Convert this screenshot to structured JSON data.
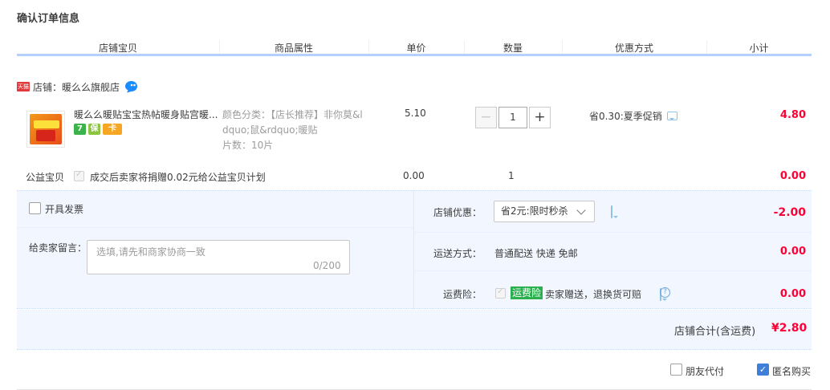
{
  "page": {
    "title": "确认订单信息"
  },
  "columns": [
    "店铺宝贝",
    "商品属性",
    "单价",
    "数量",
    "优惠方式",
    "小计"
  ],
  "shop": {
    "badge": "天猫",
    "label": "店铺：暖么么旗舰店"
  },
  "item": {
    "title": "暖么么暖贴宝宝热帖暖身贴宫暖...",
    "service_icons": [
      "7",
      "保",
      "卡"
    ],
    "attr_line1": "颜色分类：【店长推荐】非你莫&l",
    "attr_line2": "dquo;鼠&rdquo;暖贴",
    "attr_line3": "片数：10片",
    "price": "5.10",
    "quantity": "1",
    "qty_minus": "−",
    "qty_plus": "+",
    "promo": "省0.30:夏季促销",
    "subtotal": "4.80"
  },
  "charity": {
    "label": "公益宝贝",
    "text": "成交后卖家将捐赠0.02元给公益宝贝计划",
    "price": "0.00",
    "quantity": "1",
    "subtotal": "0.00"
  },
  "invoice": {
    "label": "开具发票",
    "checked": false
  },
  "message": {
    "label": "给卖家留言：",
    "placeholder": "选填,请先和商家协商一致",
    "counter": "0/200"
  },
  "discount": {
    "label": "店铺优惠：",
    "selected": "省2元:限时秒杀",
    "amount": "-2.00"
  },
  "shipping": {
    "label": "运送方式：",
    "value": "普通配送 快递 免邮",
    "amount": "0.00"
  },
  "insurance": {
    "label": "运费险：",
    "badge": "运费险",
    "text": "卖家赠送，退换货可赔",
    "help": "?",
    "amount": "0.00"
  },
  "total": {
    "label": "店铺合计(含运费)",
    "value": "¥2.80"
  },
  "options": {
    "friend_pay": "朋友代付",
    "anonymous": "匿名购买",
    "anonymous_checked": true
  },
  "colors": {
    "accent_red": "#ff0036",
    "header_rule": "#b2d1ff",
    "panel_bg": "#f2f7ff",
    "checkbox_blue": "#3d7fd9"
  }
}
